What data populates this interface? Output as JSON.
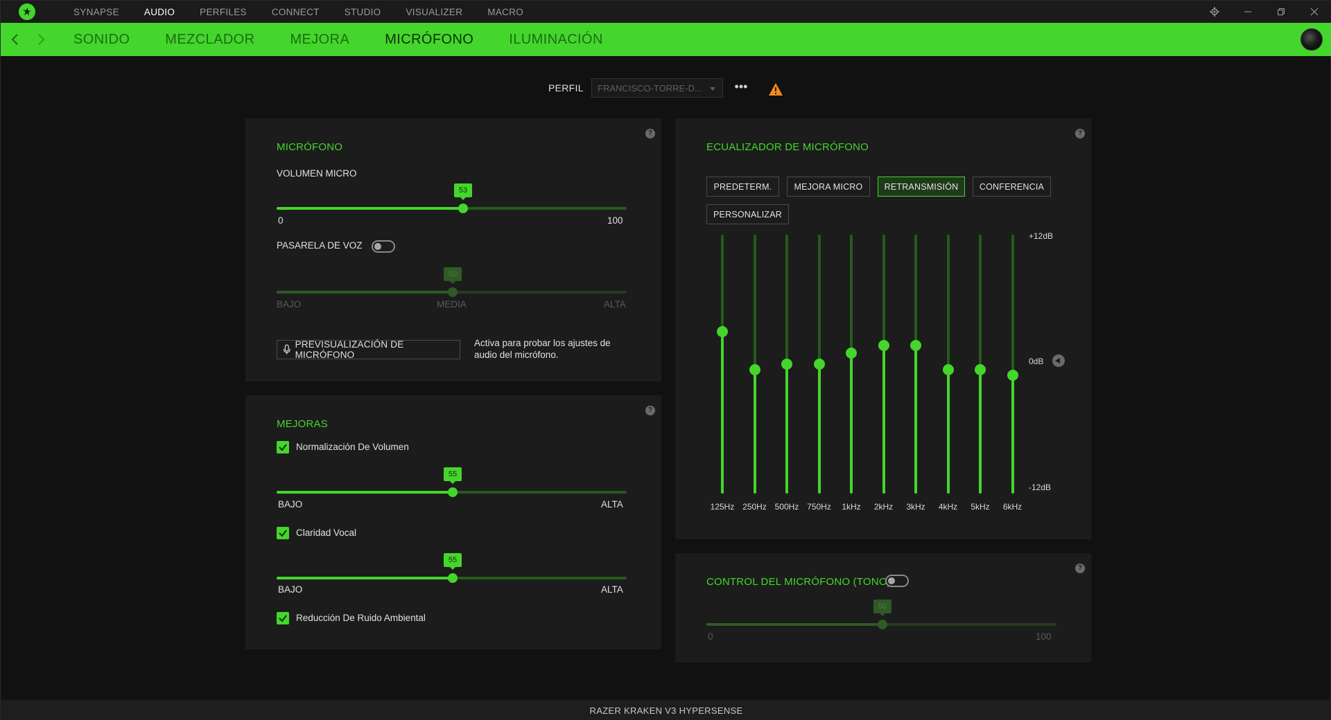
{
  "app": {
    "top_nav": [
      "SYNAPSE",
      "AUDIO",
      "PERFILES",
      "CONNECT",
      "STUDIO",
      "VISUALIZER",
      "MACRO"
    ],
    "top_nav_active": "AUDIO",
    "sub_nav": [
      "SONIDO",
      "MEZCLADOR",
      "MEJORA",
      "MICRÓFONO",
      "ILUMINACIÓN"
    ],
    "sub_nav_active": "MICRÓFONO",
    "accent_color": "#44d62c"
  },
  "profile": {
    "label": "PERFIL",
    "selected": "FRANCISCO-TORRE-D...",
    "more": "•••"
  },
  "microphone": {
    "title": "MICRÓFONO",
    "volume_label": "VOLUMEN MICRO",
    "volume_value": "53",
    "volume_min": "0",
    "volume_max": "100",
    "gate_label": "PASARELA DE VOZ",
    "gate_enabled": false,
    "gate_value": "50",
    "gate_low": "BAJO",
    "gate_mid": "MEDIA",
    "gate_high": "ALTA",
    "preview_button": "PREVISUALIZACIÓN DE MICRÓFONO",
    "preview_hint_1": "Activa para probar los ajustes de",
    "preview_hint_2": "audio del micrófono."
  },
  "enhancements": {
    "title": "MEJORAS",
    "normalization_label": "Normalización De Volumen",
    "normalization_value": "55",
    "clarity_label": "Claridad Vocal",
    "clarity_value": "55",
    "noise_label": "Reducción De Ruido Ambiental",
    "low": "BAJO",
    "high": "ALTA"
  },
  "equalizer": {
    "title": "ECUALIZADOR DE MICRÓFONO",
    "presets": [
      "PREDETERM.",
      "MEJORA MICRO",
      "RETRANSMISIÓN",
      "CONFERENCIA",
      "PERSONALIZAR"
    ],
    "active_preset": "RETRANSMISIÓN",
    "db_top": "+12dB",
    "db_mid": "0dB",
    "db_bottom": "-12dB",
    "bands": [
      {
        "freq": "125Hz",
        "gain_db": 3.0
      },
      {
        "freq": "250Hz",
        "gain_db": -0.5
      },
      {
        "freq": "500Hz",
        "gain_db": 0.0
      },
      {
        "freq": "750Hz",
        "gain_db": 0.0
      },
      {
        "freq": "1kHz",
        "gain_db": 1.0
      },
      {
        "freq": "2kHz",
        "gain_db": 1.75
      },
      {
        "freq": "3kHz",
        "gain_db": 1.75
      },
      {
        "freq": "4kHz",
        "gain_db": -0.5
      },
      {
        "freq": "5kHz",
        "gain_db": -0.5
      },
      {
        "freq": "6kHz",
        "gain_db": -1.0
      }
    ]
  },
  "sidetone": {
    "title": "CONTROL DEL MICRÓFONO (TONO)",
    "enabled": false,
    "value": "50",
    "min": "0",
    "max": "100"
  },
  "status": {
    "device": "RAZER KRAKEN V3 HYPERSENSE"
  }
}
